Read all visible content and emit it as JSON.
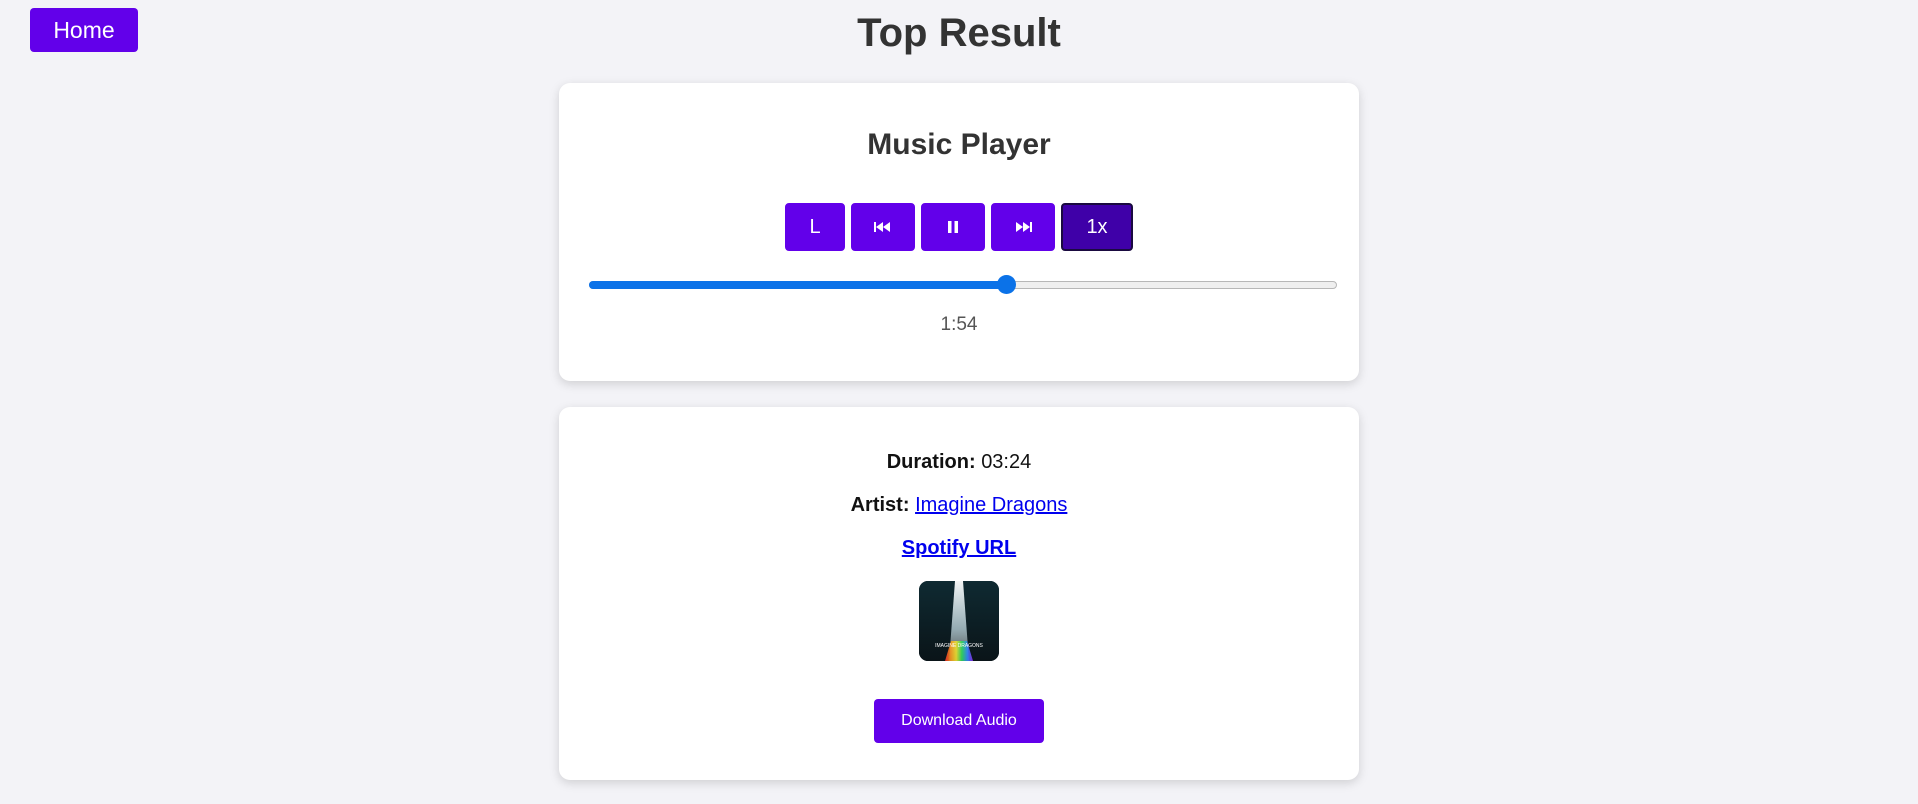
{
  "nav": {
    "home_label": "Home"
  },
  "page": {
    "title": "Top Result"
  },
  "player": {
    "title": "Music Player",
    "controls": {
      "loop_label": "L",
      "previous_icon": "previous-track-icon",
      "pause_icon": "pause-icon",
      "next_icon": "next-track-icon",
      "speed_label": "1x"
    },
    "progress_fraction": 0.557,
    "current_time": "1:54"
  },
  "track": {
    "duration_label": "Duration:",
    "duration_value": "03:24",
    "artist_label": "Artist:",
    "artist_name": "Imagine Dragons",
    "spotify_link_text": "Spotify URL",
    "album_art_text": "IMAGINE DRAGONS",
    "download_label": "Download Audio"
  },
  "colors": {
    "accent": "#6200ea",
    "accent_active": "#3f00a8",
    "progress": "#0b72e8",
    "link": "#0000ee",
    "background": "#f3f3f7"
  }
}
